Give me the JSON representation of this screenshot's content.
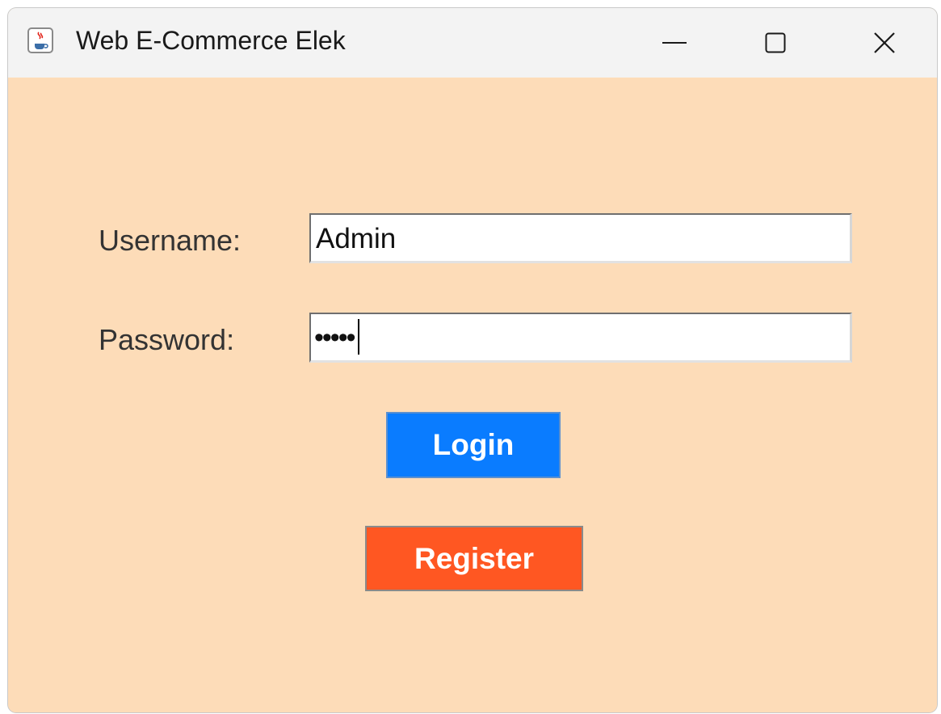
{
  "window": {
    "title": "Web E-Commerce Elek",
    "app_icon": "java-coffee-icon",
    "controls": {
      "minimize_icon": "minimize-icon",
      "maximize_icon": "maximize-icon",
      "close_icon": "close-icon"
    }
  },
  "form": {
    "username_label": "Username:",
    "username_value": "Admin",
    "password_label": "Password:",
    "password_masked": "•••••",
    "login_label": "Login",
    "register_label": "Register"
  },
  "colors": {
    "background": "#fddcb8",
    "login_button": "#0a7cff",
    "register_button": "#ff5722",
    "titlebar": "#f3f3f3"
  }
}
